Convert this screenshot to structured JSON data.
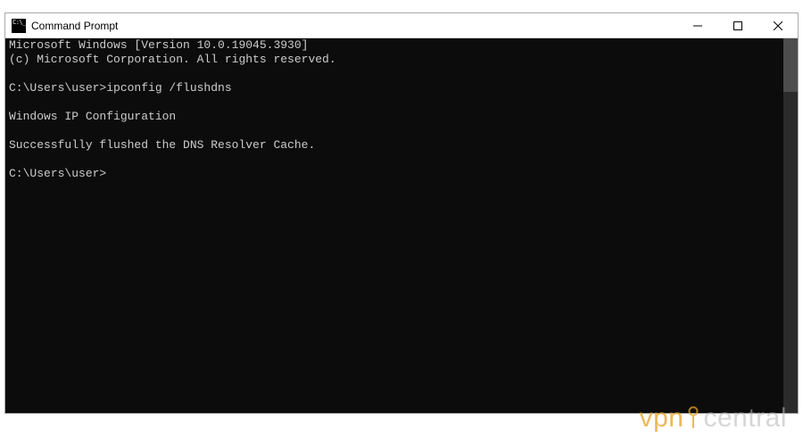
{
  "window": {
    "title": "Command Prompt"
  },
  "console": {
    "lines": [
      "Microsoft Windows [Version 10.0.19045.3930]",
      "(c) Microsoft Corporation. All rights reserved.",
      "",
      "C:\\Users\\user>ipconfig /flushdns",
      "",
      "Windows IP Configuration",
      "",
      "Successfully flushed the DNS Resolver Cache.",
      "",
      "C:\\Users\\user>"
    ]
  },
  "watermark": {
    "part1": "vpn",
    "part2": "central"
  }
}
